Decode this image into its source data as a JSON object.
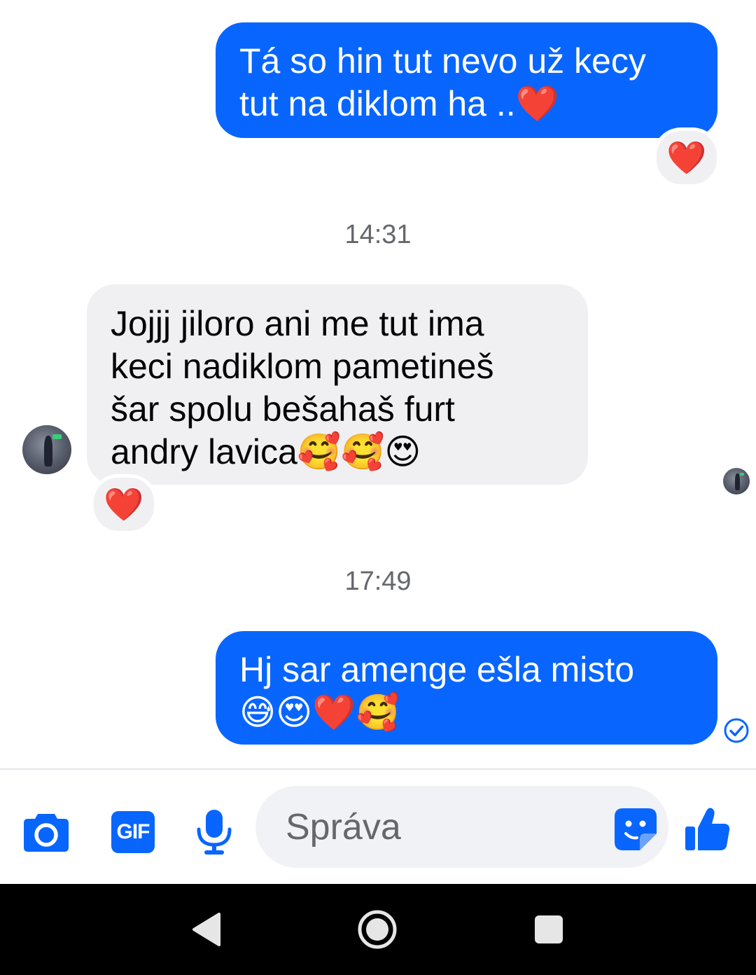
{
  "messages": [
    {
      "direction": "outgoing",
      "lines": [
        "Tá so hin tut nevo už kecy",
        "tut na diklom ha ..❤️"
      ],
      "reaction": "❤️"
    },
    {
      "timestamp": "14:31"
    },
    {
      "direction": "incoming",
      "lines": [
        "Jojjj jiloro ani me tut ima",
        "keci nadiklom pametineš",
        "šar spolu bešahaš furt",
        "andry lavica🥰🥰😍"
      ],
      "reaction": "❤️"
    },
    {
      "timestamp": "17:49"
    },
    {
      "direction": "outgoing",
      "lines": [
        "Hj sar amenge ešla misto",
        "😅😍❤️🥰"
      ],
      "status": "sent"
    }
  ],
  "composer": {
    "placeholder": "Správa",
    "icons": [
      "camera-icon",
      "gif-icon",
      "microphone-icon",
      "sticker-icon",
      "like-icon"
    ],
    "gif_label": "GIF"
  },
  "navbar": {
    "icons": [
      "back-icon",
      "home-icon",
      "recents-icon"
    ]
  },
  "colors": {
    "accent": "#0866ff",
    "incoming_bubble": "#f0f0f3",
    "timestamp": "#65676b"
  }
}
